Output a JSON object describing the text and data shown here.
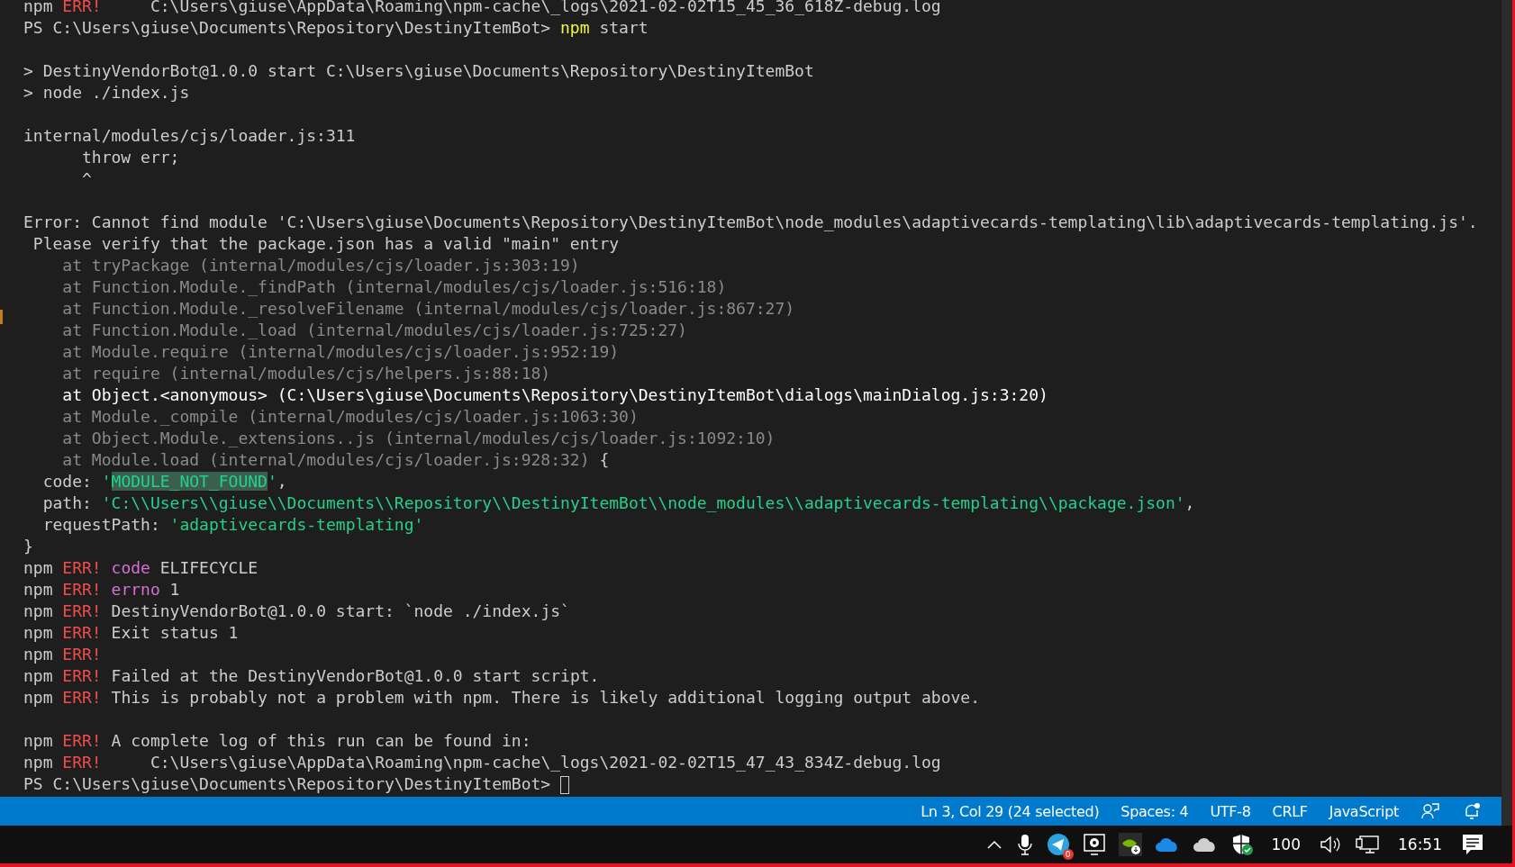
{
  "terminal": {
    "lines": [
      {
        "kind": "text",
        "spans": [
          {
            "text": "npm ",
            "kind": "plain"
          },
          {
            "text": "ERR!",
            "kind": "error"
          },
          {
            "text": "     C:\\Users\\giuse\\AppData\\Roaming\\npm-cache\\_logs\\2021-02-02T15_45_36_618Z-debug.log",
            "kind": "plain"
          }
        ]
      },
      {
        "kind": "text",
        "spans": [
          {
            "text": "PS C:\\Users\\giuse\\Documents\\Repository\\DestinyItemBot> ",
            "kind": "plain"
          },
          {
            "text": "npm",
            "kind": "command"
          },
          {
            "text": " start",
            "kind": "plain"
          }
        ]
      },
      {
        "kind": "blank"
      },
      {
        "kind": "text",
        "spans": [
          {
            "text": "> DestinyVendorBot@1.0.0 start C:\\Users\\giuse\\Documents\\Repository\\DestinyItemBot",
            "kind": "plain"
          }
        ]
      },
      {
        "kind": "text",
        "spans": [
          {
            "text": "> node ./index.js",
            "kind": "plain"
          }
        ]
      },
      {
        "kind": "blank"
      },
      {
        "kind": "text",
        "spans": [
          {
            "text": "internal/modules/cjs/loader.js:311",
            "kind": "plain"
          }
        ]
      },
      {
        "kind": "text",
        "spans": [
          {
            "text": "      throw err;",
            "kind": "plain"
          }
        ]
      },
      {
        "kind": "text",
        "spans": [
          {
            "text": "      ^",
            "kind": "plain"
          }
        ]
      },
      {
        "kind": "blank"
      },
      {
        "kind": "text",
        "spans": [
          {
            "text": "Error: Cannot find module 'C:\\Users\\giuse\\Documents\\Repository\\DestinyItemBot\\node_modules\\adaptivecards-templating\\lib\\adaptivecards-templating.js'.",
            "kind": "plain"
          }
        ]
      },
      {
        "kind": "text",
        "spans": [
          {
            "text": " Please verify that the package.json has a valid \"main\" entry",
            "kind": "plain"
          }
        ]
      },
      {
        "kind": "text",
        "spans": [
          {
            "text": "    at tryPackage (internal/modules/cjs/loader.js:303:19)",
            "kind": "dim"
          }
        ]
      },
      {
        "kind": "text",
        "spans": [
          {
            "text": "    at Function.Module._findPath (internal/modules/cjs/loader.js:516:18)",
            "kind": "dim"
          }
        ]
      },
      {
        "kind": "text",
        "spans": [
          {
            "text": "    at Function.Module._resolveFilename (internal/modules/cjs/loader.js:867:27)",
            "kind": "dim"
          }
        ]
      },
      {
        "kind": "text",
        "spans": [
          {
            "text": "    at Function.Module._load (internal/modules/cjs/loader.js:725:27)",
            "kind": "dim"
          }
        ]
      },
      {
        "kind": "text",
        "spans": [
          {
            "text": "    at Module.require (internal/modules/cjs/loader.js:952:19)",
            "kind": "dim"
          }
        ]
      },
      {
        "kind": "text",
        "spans": [
          {
            "text": "    at require (internal/modules/cjs/helpers.js:88:18)",
            "kind": "dim"
          }
        ]
      },
      {
        "kind": "text",
        "spans": [
          {
            "text": "    at Object.<anonymous> (C:\\Users\\giuse\\Documents\\Repository\\DestinyItemBot\\dialogs\\mainDialog.js:3:20)",
            "kind": "bright"
          }
        ]
      },
      {
        "kind": "text",
        "spans": [
          {
            "text": "    at Module._compile (internal/modules/cjs/loader.js:1063:30)",
            "kind": "dim"
          }
        ]
      },
      {
        "kind": "text",
        "spans": [
          {
            "text": "    at Object.Module._extensions..js (internal/modules/cjs/loader.js:1092:10)",
            "kind": "dim"
          }
        ]
      },
      {
        "kind": "text",
        "spans": [
          {
            "text": "    at Module.load (internal/modules/cjs/loader.js:928:32)",
            "kind": "dim"
          },
          {
            "text": " {",
            "kind": "plain"
          }
        ]
      },
      {
        "kind": "text",
        "spans": [
          {
            "text": "  code: ",
            "kind": "plain"
          },
          {
            "text": "'",
            "kind": "string"
          },
          {
            "text": "MODULE_NOT_FOUND",
            "kind": "match"
          },
          {
            "text": "'",
            "kind": "string"
          },
          {
            "text": ",",
            "kind": "plain"
          }
        ]
      },
      {
        "kind": "text",
        "spans": [
          {
            "text": "  path: ",
            "kind": "plain"
          },
          {
            "text": "'C:\\\\Users\\\\giuse\\\\Documents\\\\Repository\\\\DestinyItemBot\\\\node_modules\\\\adaptivecards-templating\\\\package.json'",
            "kind": "string"
          },
          {
            "text": ",",
            "kind": "plain"
          }
        ]
      },
      {
        "kind": "text",
        "spans": [
          {
            "text": "  requestPath: ",
            "kind": "plain"
          },
          {
            "text": "'adaptivecards-templating'",
            "kind": "string"
          }
        ]
      },
      {
        "kind": "text",
        "spans": [
          {
            "text": "}",
            "kind": "plain"
          }
        ]
      },
      {
        "kind": "text",
        "spans": [
          {
            "text": "npm ",
            "kind": "plain"
          },
          {
            "text": "ERR!",
            "kind": "error"
          },
          {
            "text": " code",
            "kind": "keyword"
          },
          {
            "text": " ELIFECYCLE",
            "kind": "plain"
          }
        ]
      },
      {
        "kind": "text",
        "spans": [
          {
            "text": "npm ",
            "kind": "plain"
          },
          {
            "text": "ERR!",
            "kind": "error"
          },
          {
            "text": " errno",
            "kind": "keyword"
          },
          {
            "text": " 1",
            "kind": "plain"
          }
        ]
      },
      {
        "kind": "text",
        "spans": [
          {
            "text": "npm ",
            "kind": "plain"
          },
          {
            "text": "ERR!",
            "kind": "error"
          },
          {
            "text": " DestinyVendorBot@1.0.0 start: `node ./index.js`",
            "kind": "plain"
          }
        ]
      },
      {
        "kind": "text",
        "spans": [
          {
            "text": "npm ",
            "kind": "plain"
          },
          {
            "text": "ERR!",
            "kind": "error"
          },
          {
            "text": " Exit status 1",
            "kind": "plain"
          }
        ]
      },
      {
        "kind": "text",
        "spans": [
          {
            "text": "npm ",
            "kind": "plain"
          },
          {
            "text": "ERR!",
            "kind": "error"
          }
        ]
      },
      {
        "kind": "text",
        "spans": [
          {
            "text": "npm ",
            "kind": "plain"
          },
          {
            "text": "ERR!",
            "kind": "error"
          },
          {
            "text": " Failed at the DestinyVendorBot@1.0.0 start script.",
            "kind": "plain"
          }
        ]
      },
      {
        "kind": "text",
        "spans": [
          {
            "text": "npm ",
            "kind": "plain"
          },
          {
            "text": "ERR!",
            "kind": "error"
          },
          {
            "text": " This is probably not a problem with npm. There is likely additional logging output above.",
            "kind": "plain"
          }
        ]
      },
      {
        "kind": "blank"
      },
      {
        "kind": "text",
        "spans": [
          {
            "text": "npm ",
            "kind": "plain"
          },
          {
            "text": "ERR!",
            "kind": "error"
          },
          {
            "text": " A complete log of this run can be found in:",
            "kind": "plain"
          }
        ]
      },
      {
        "kind": "text",
        "spans": [
          {
            "text": "npm ",
            "kind": "plain"
          },
          {
            "text": "ERR!",
            "kind": "error"
          },
          {
            "text": "     C:\\Users\\giuse\\AppData\\Roaming\\npm-cache\\_logs\\2021-02-02T15_47_43_834Z-debug.log",
            "kind": "plain"
          }
        ]
      },
      {
        "kind": "prompt",
        "spans": [
          {
            "text": "PS C:\\Users\\giuse\\Documents\\Repository\\DestinyItemBot> ",
            "kind": "plain"
          }
        ]
      }
    ]
  },
  "status_bar": {
    "items": [
      "Ln 3, Col 29 (24 selected)",
      "Spaces: 4",
      "UTF-8",
      "CRLF",
      "JavaScript"
    ]
  },
  "taskbar": {
    "battery": "100",
    "clock": "16:51",
    "telegram_badge": "0"
  }
}
